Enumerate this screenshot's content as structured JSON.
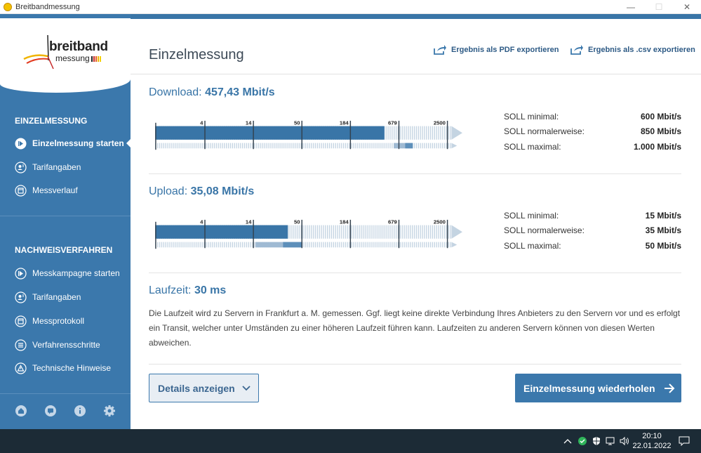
{
  "window": {
    "title": "Breitbandmessung",
    "minimize": "—",
    "maximize": "☐",
    "close": "✕"
  },
  "logo": {
    "line1": "breitband",
    "line2": "messung"
  },
  "sidebar": {
    "section1": "EINZELMESSUNG",
    "items1": [
      {
        "label": "Einzelmessung starten",
        "icon": "play-icon",
        "active": true
      },
      {
        "label": "Tarifangaben",
        "icon": "user-icon"
      },
      {
        "label": "Messverlauf",
        "icon": "calendar-icon"
      }
    ],
    "section2": "NACHWEISVERFAHREN",
    "items2": [
      {
        "label": "Messkampagne starten",
        "icon": "play-icon"
      },
      {
        "label": "Tarifangaben",
        "icon": "user-icon"
      },
      {
        "label": "Messprotokoll",
        "icon": "calendar-icon"
      },
      {
        "label": "Verfahrensschritte",
        "icon": "list-icon"
      },
      {
        "label": "Technische Hinweise",
        "icon": "warning-icon"
      }
    ],
    "bottom_icons": [
      "home-icon",
      "chat-icon",
      "info-icon",
      "gear-icon"
    ]
  },
  "main": {
    "title": "Einzelmessung",
    "export_pdf": "Ergebnis als PDF exportieren",
    "export_csv": "Ergebnis als .csv exportieren",
    "download": {
      "label": "Download:",
      "value": "457,43 Mbit/s",
      "measured_mbit": 457.43,
      "soll": [
        {
          "label": "SOLL minimal:",
          "value": "600 Mbit/s"
        },
        {
          "label": "SOLL normalerweise:",
          "value": "850 Mbit/s"
        },
        {
          "label": "SOLL maximal:",
          "value": "1.000 Mbit/s"
        }
      ]
    },
    "upload": {
      "label": "Upload:",
      "value": "35,08 Mbit/s",
      "measured_mbit": 35.08,
      "soll": [
        {
          "label": "SOLL minimal:",
          "value": "15 Mbit/s"
        },
        {
          "label": "SOLL normalerweise:",
          "value": "35 Mbit/s"
        },
        {
          "label": "SOLL maximal:",
          "value": "50 Mbit/s"
        }
      ]
    },
    "scale_ticks": [
      "4",
      "14",
      "50",
      "184",
      "679",
      "2500"
    ],
    "latency": {
      "label": "Laufzeit:",
      "value": "30 ms",
      "text": "Die Laufzeit wird zu Servern in Frankfurt a. M. gemessen. Ggf. liegt keine direkte Verbindung Ihres Anbieters zu den Servern vor und es erfolgt ein Transit, welcher unter Umständen zu einer höheren Laufzeit führen kann. Laufzeiten zu anderen Servern können von diesen Werten abweichen."
    },
    "details_button": "Details anzeigen",
    "repeat_button": "Einzelmessung wiederholen"
  },
  "taskbar": {
    "time": "20:10",
    "date": "22.01.2022"
  },
  "colors": {
    "sidebar": "#3b78ac",
    "accent": "#3975a7",
    "taskbar": "#1c2b36"
  }
}
